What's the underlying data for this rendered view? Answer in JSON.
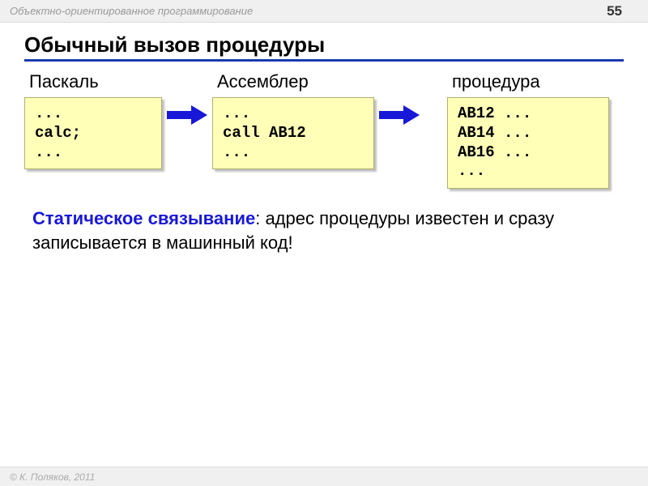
{
  "header": {
    "title": "Объектно-ориентированное программирование",
    "page": "55"
  },
  "slide": {
    "title": "Обычный вызов процедуры"
  },
  "columns": {
    "pascal": {
      "label": "Паскаль",
      "code": "...\ncalc;\n..."
    },
    "asm": {
      "label": "Ассемблер",
      "code": "...\ncall AB12\n..."
    },
    "proc": {
      "label": "процедура",
      "code": "AB12 ...\nAB14 ...\nAB16 ...\n..."
    }
  },
  "definition": {
    "term": "Статическое связывание",
    "rest": ": адрес процедуры известен и сразу записывается в машинный код!"
  },
  "footer": {
    "copyright": "© К. Поляков, 2011"
  }
}
